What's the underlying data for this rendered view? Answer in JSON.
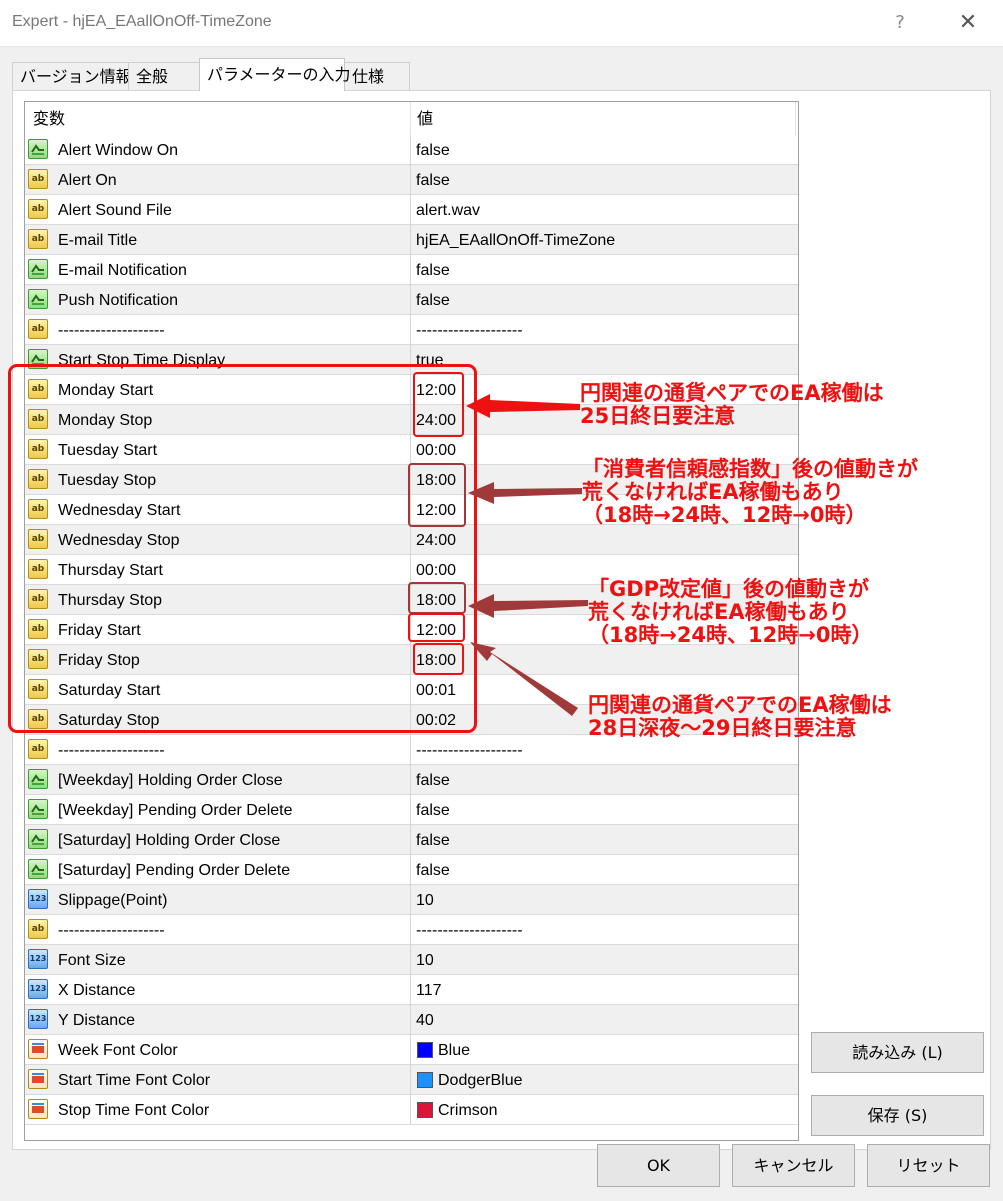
{
  "window": {
    "title": "Expert - hjEA_EAallOnOff-TimeZone",
    "help_glyph": "?",
    "close_glyph": "✕"
  },
  "tabs": [
    {
      "label": "バージョン情報",
      "active": false
    },
    {
      "label": "全般",
      "active": false
    },
    {
      "label": "パラメーターの入力",
      "active": true
    },
    {
      "label": "仕様",
      "active": false
    }
  ],
  "grid": {
    "header_variable": "変数",
    "header_value": "値",
    "rows": [
      {
        "icon": "bool-icon",
        "name": "Alert Window On",
        "value": "false"
      },
      {
        "icon": "string-icon",
        "name": "Alert On",
        "value": "false"
      },
      {
        "icon": "string-icon",
        "name": "Alert Sound File",
        "value": "alert.wav"
      },
      {
        "icon": "string-icon",
        "name": "E-mail Title",
        "value": "hjEA_EAallOnOff-TimeZone"
      },
      {
        "icon": "bool-icon",
        "name": "E-mail Notification",
        "value": "false"
      },
      {
        "icon": "bool-icon",
        "name": "Push Notification",
        "value": "false"
      },
      {
        "icon": "string-icon",
        "name": "--------------------",
        "value": "--------------------"
      },
      {
        "icon": "bool-icon",
        "name": "Start Stop Time Display",
        "value": "true"
      },
      {
        "icon": "string-icon",
        "name": "Monday Start",
        "value": "12:00"
      },
      {
        "icon": "string-icon",
        "name": "Monday Stop",
        "value": "24:00"
      },
      {
        "icon": "string-icon",
        "name": "Tuesday Start",
        "value": "00:00"
      },
      {
        "icon": "string-icon",
        "name": "Tuesday Stop",
        "value": "18:00"
      },
      {
        "icon": "string-icon",
        "name": "Wednesday Start",
        "value": "12:00"
      },
      {
        "icon": "string-icon",
        "name": "Wednesday Stop",
        "value": "24:00"
      },
      {
        "icon": "string-icon",
        "name": "Thursday Start",
        "value": "00:00"
      },
      {
        "icon": "string-icon",
        "name": "Thursday Stop",
        "value": "18:00"
      },
      {
        "icon": "string-icon",
        "name": "Friday Start",
        "value": "12:00"
      },
      {
        "icon": "string-icon",
        "name": "Friday Stop",
        "value": "18:00"
      },
      {
        "icon": "string-icon",
        "name": "Saturday Start",
        "value": "00:01"
      },
      {
        "icon": "string-icon",
        "name": "Saturday Stop",
        "value": "00:02"
      },
      {
        "icon": "string-icon",
        "name": "--------------------",
        "value": "--------------------"
      },
      {
        "icon": "bool-icon",
        "name": "[Weekday]  Holding Order Close",
        "value": "false"
      },
      {
        "icon": "bool-icon",
        "name": "[Weekday]  Pending Order Delete",
        "value": "false"
      },
      {
        "icon": "bool-icon",
        "name": "[Saturday]   Holding Order Close",
        "value": "false"
      },
      {
        "icon": "bool-icon",
        "name": "[Saturday]   Pending Order Delete",
        "value": "false"
      },
      {
        "icon": "number-icon",
        "name": "Slippage(Point)",
        "value": "10"
      },
      {
        "icon": "string-icon",
        "name": "--------------------",
        "value": "--------------------"
      },
      {
        "icon": "number-icon",
        "name": "Font Size",
        "value": "10"
      },
      {
        "icon": "number-icon",
        "name": "X Distance",
        "value": "117"
      },
      {
        "icon": "number-icon",
        "name": "Y Distance",
        "value": "40"
      },
      {
        "icon": "color-icon",
        "name": "Week Font Color",
        "value": "Blue",
        "swatch": "#0000ff"
      },
      {
        "icon": "color-icon",
        "name": "Start Time Font Color",
        "value": "DodgerBlue",
        "swatch": "#1e90ff"
      },
      {
        "icon": "color-icon",
        "name": "Stop Time Font Color",
        "value": "Crimson",
        "swatch": "#dc143c"
      }
    ]
  },
  "buttons": {
    "load": "読み込み (L)",
    "save": "保存 (S)",
    "ok": "OK",
    "cancel": "キャンセル",
    "reset": "リセット"
  },
  "icon_labels": {
    "string": "ab",
    "number": "123"
  },
  "annotations": [
    {
      "lines": [
        "円関連の通貨ペアでのEA稼働は",
        "25日終日要注意"
      ]
    },
    {
      "lines": [
        "「消費者信頼感指数」後の値動きが",
        "荒くなければEA稼働もあり",
        "（18時→24時、12時→0時）"
      ]
    },
    {
      "lines": [
        "「GDP改定値」後の値動きが",
        "荒くなければEA稼働もあり",
        "（18時→24時、12時→0時）"
      ]
    },
    {
      "lines": [
        "円関連の通貨ペアでのEA稼働は",
        "28日深夜～29日終日要注意"
      ]
    }
  ],
  "colors": {
    "annotation_red": "#ee1111",
    "annotation_brown": "#a03a3a"
  }
}
